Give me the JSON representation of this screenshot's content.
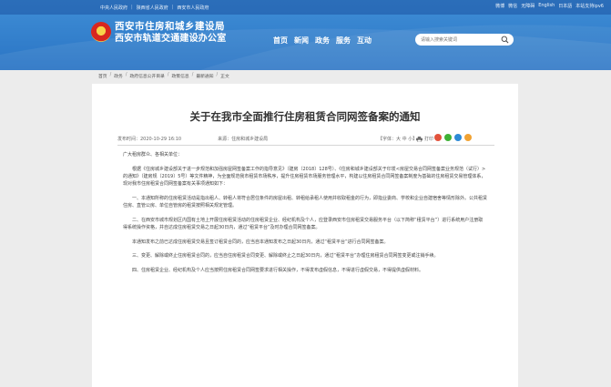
{
  "topbar": {
    "links": [
      "中央人民政府",
      "陕西省人民政府",
      "西安市人民政府"
    ],
    "tools": [
      "微博",
      "微信",
      "无障碍",
      "English",
      "日本語",
      "本站支持ipv6"
    ]
  },
  "site": {
    "title_line1": "西安市住房和城乡建设局",
    "title_line2": "西安市轨道交通建设办公室"
  },
  "nav": {
    "items": [
      "首页",
      "新闻",
      "政务",
      "服务",
      "互动"
    ]
  },
  "search": {
    "placeholder": "请输入搜索关键词"
  },
  "breadcrumb": {
    "items": [
      "首页",
      "政务",
      "政府信息公开目录",
      "政策信息",
      "最新通知",
      "正文"
    ]
  },
  "article": {
    "title": "关于在我市全面推行住房租赁合同网签备案的通知",
    "date": "发布时间：2020-10-29 16:10",
    "source": "来源：住房和城乡建设局",
    "font_size": "【字体：大 中 小】",
    "print_label": "打印",
    "paragraphs": [
      "广大租房群众、各相关单位：",
      "根据《住房城乡建设部关于进一步规范和加强房屋网签备案工作的指导意见》（建房〔2018〕128号）、《住房和城乡建设部关于印发<房屋交易合同网签备案业务规范（试行）>的通知》（建房规〔2019〕5号）等文件精神，为全面规范我市租赁市场秩序，提升住房租赁市场服务管理水平，构建以住房租赁合同网签备案制度为基础的住房租赁交易管理体系，现对我市住房租赁合同网签备案有关事项通知如下：",
      "一、本通知所称的住房租赁活动是指出租人、转租人将符合居住条件的房屋出租、转租给承租人使用并收取租金的行为，即指业委商、学校和企业自建宿舍等情形除外。公共租赁住房、直管公房、单位自管房的租赁按照相关规定管理。",
      "二、在西安市城市规划区内国有土地上开展住房租赁活动的住房租赁企业、经纪机构及个人，应登录西安市住房租赁交易服务平台（以下简称“租赁平台”）进行系统用户注册取得系统操作资格，并自达成住房租赁交易之日起30日内，通过“租赁平台”及时办理合同网签备案。",
      "本通知发布之前已达成住房租赁交易且签订租赁合同的，应当自本通知发布之日起30日内，通过“租赁平台”进行合同网签备案。",
      "三、变更、解除或终止住房租赁合同的，应当自住房租赁合同变更、解除或终止之日起30日内，通过“租赁平台”办理住房租赁合同网签变更或注销手续。",
      "四、住房租赁企业、经纪机构及个人应当按照住房租赁合同网签要求进行相关操作，不得发布虚假信息，不得进行虚假交易，不得提供虚假材料。"
    ]
  },
  "colors": {
    "header_blue": "#2a74c4",
    "emblem_red": "#d8261f",
    "emblem_gold": "#f2c640"
  }
}
